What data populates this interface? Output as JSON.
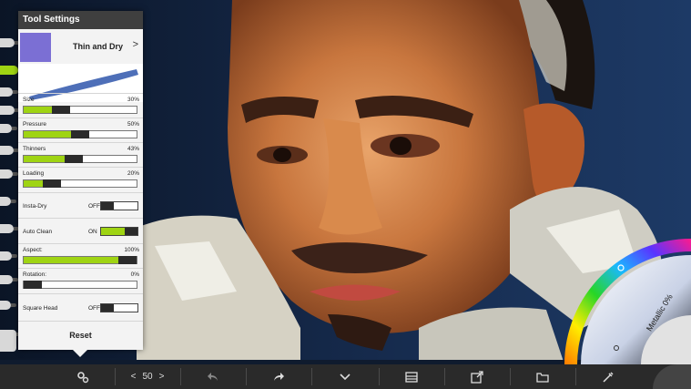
{
  "panel": {
    "title": "Tool Settings",
    "brush_name": "Thin and Dry",
    "next_glyph": ">",
    "reset_label": "Reset",
    "sliders": [
      {
        "label": "Size",
        "value_text": "30%",
        "level": 0.3
      },
      {
        "label": "Pressure",
        "value_text": "50%",
        "level": 0.5
      },
      {
        "label": "Thinners",
        "value_text": "43%",
        "level": 0.43
      },
      {
        "label": "Loading",
        "value_text": "20%",
        "level": 0.2
      }
    ],
    "toggles": {
      "insta_dry": {
        "label": "Insta-Dry",
        "state": "OFF"
      },
      "auto_clean": {
        "label": "Auto Clean",
        "state": "ON"
      },
      "square_head": {
        "label": "Square Head",
        "state": "OFF"
      }
    },
    "aspect": {
      "label": "Aspect:",
      "value_text": "100%",
      "level": 1.0
    },
    "rotation": {
      "label": "Rotation:",
      "value_text": "0%",
      "level": 0.0
    }
  },
  "color_wheel": {
    "metallic_label": "Metallic 0%"
  },
  "toolbar": {
    "brush_size_prev": "<",
    "brush_size_value": "50",
    "brush_size_next": ">",
    "icons": [
      "settings-icon",
      "undo-icon",
      "redo-icon",
      "chevron-down-icon",
      "layers-icon",
      "export-icon",
      "folder-icon",
      "eyedropper-icon"
    ]
  },
  "colors": {
    "accent": "#9fd413",
    "panel_header": "#3f3f3f",
    "toolbar": "#2a2a2a",
    "canvas_bg": "#0f1b2e"
  }
}
